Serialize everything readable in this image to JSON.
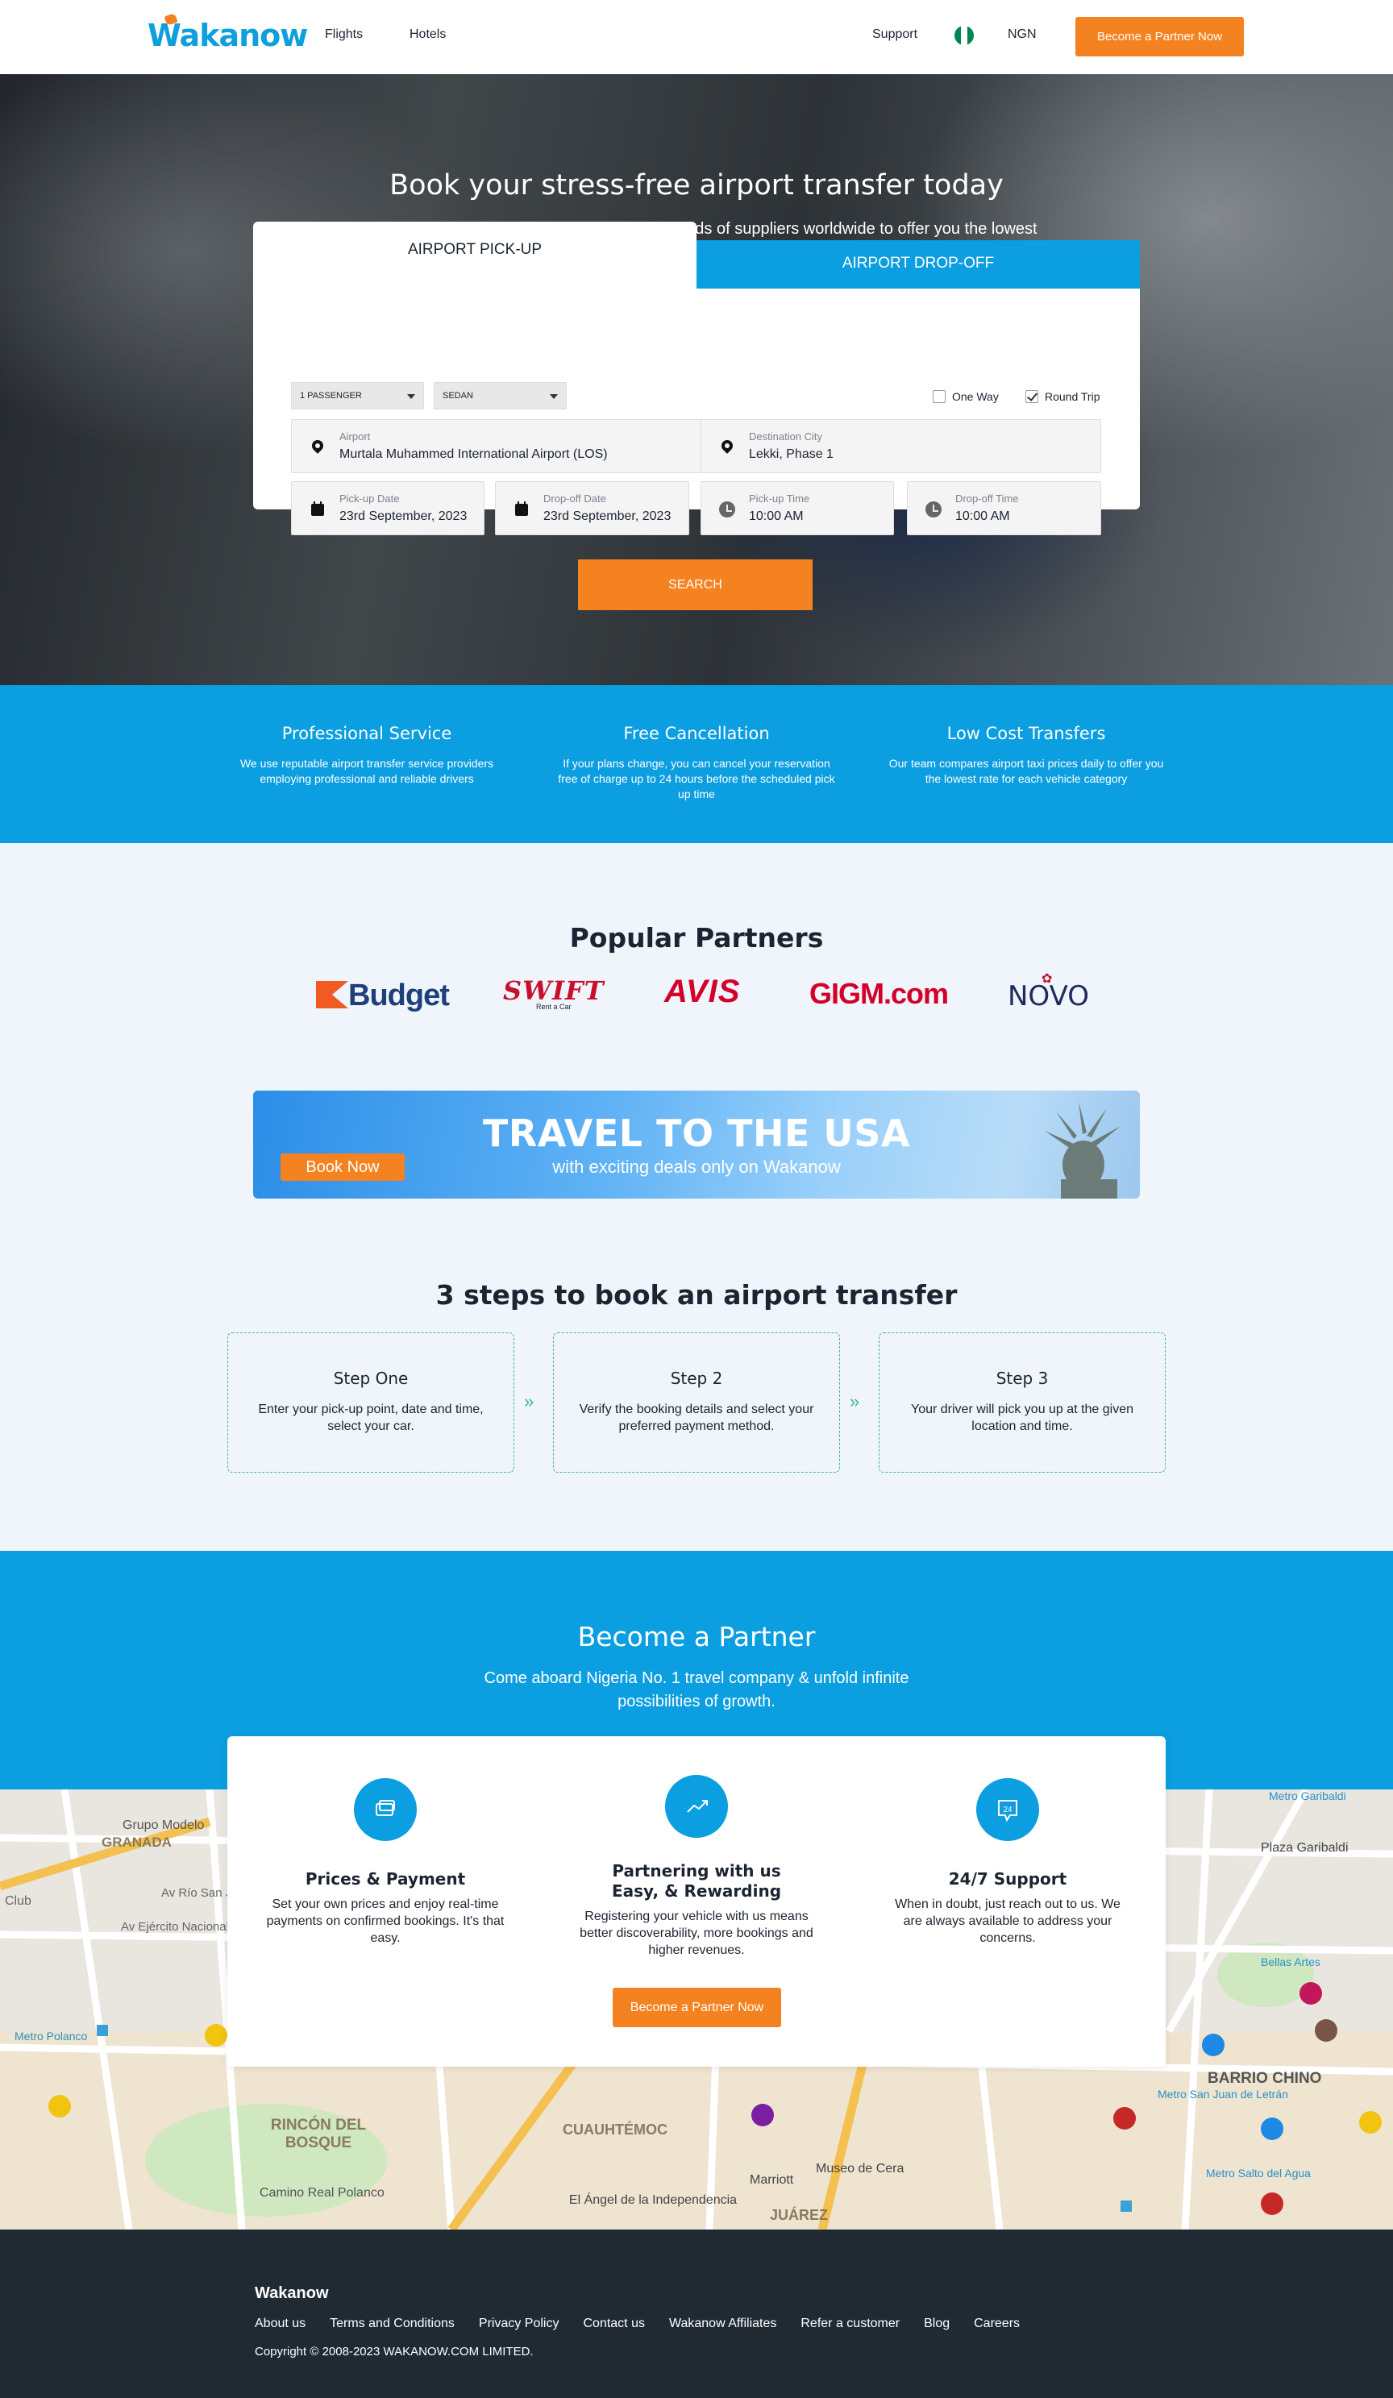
{
  "nav": {
    "logo": "Wakanow",
    "links": [
      "Flights",
      "Hotels"
    ],
    "support": "Support",
    "currency": "NGN",
    "partner_cta": "Become a Partner Now",
    "flag_colors": [
      "#008751",
      "#ffffff",
      "#008751"
    ]
  },
  "hero": {
    "title": "Book your stress-free airport transfer today",
    "subtitle": "We compare airport transfer prices from hundreds of suppliers worldwide to offer you the lowest possible price without compromising the quality of service"
  },
  "booking": {
    "tabs": [
      "AIRPORT PICK-UP",
      "AIRPORT DROP-OFF"
    ],
    "passengers": "1 PASSENGER",
    "vehicle": "SEDAN",
    "trip_options": [
      {
        "label": "One Way",
        "checked": false
      },
      {
        "label": "Round Trip",
        "checked": true
      }
    ],
    "airport": {
      "label": "Airport",
      "value": "Murtala Muhammed International Airport (LOS)"
    },
    "destination": {
      "label": "Destination City",
      "value": "Lekki, Phase 1"
    },
    "pickup_date": {
      "label": "Pick-up Date",
      "value": "23rd September, 2023"
    },
    "dropoff_date": {
      "label": "Drop-off Date",
      "value": "23rd September, 2023"
    },
    "pickup_time": {
      "label": "Pick-up Time",
      "value": "10:00 AM"
    },
    "dropoff_time": {
      "label": "Drop-off Time",
      "value": "10:00 AM"
    },
    "search": "SEARCH"
  },
  "features": [
    {
      "title": "Professional Service",
      "text": "We use reputable airport transfer service providers employing professional and reliable drivers"
    },
    {
      "title": "Free Cancellation",
      "text": "If your plans change, you can cancel your reservation free of charge up to 24 hours before the scheduled pick up time"
    },
    {
      "title": "Low Cost Transfers",
      "text": "Our team compares airport taxi prices daily to offer you the lowest rate for each vehicle category"
    }
  ],
  "partners": {
    "title": "Popular Partners",
    "brands": [
      "Budget",
      "SWIFT",
      "Rent a Car",
      "AVIS",
      "GIGM.com",
      "NOVO"
    ]
  },
  "banner": {
    "title": "TRAVEL TO THE USA",
    "subtitle": "with exciting deals only on Wakanow",
    "cta": "Book Now"
  },
  "steps": {
    "title": "3 steps to book an airport transfer",
    "items": [
      {
        "title": "Step One",
        "text": "Enter your pick-up point, date and time, select your car."
      },
      {
        "title": "Step 2",
        "text": "Verify the booking details and select your preferred payment method."
      },
      {
        "title": "Step 3",
        "text": "Your driver will pick you up at the given location and time."
      }
    ]
  },
  "become_partner": {
    "title": "Become a Partner",
    "subtitle": "Come aboard Nigeria No. 1 travel company & unfold infinite possibilities of growth.",
    "columns": [
      {
        "title": "Prices & Payment",
        "text": "Set your own prices and enjoy real-time payments on confirmed bookings. It's that easy."
      },
      {
        "title": "Partnering with us Easy, & Rewarding",
        "text": "Registering your vehicle with us means better discoverability, more bookings and higher revenues."
      },
      {
        "title": "24/7 Support",
        "text": "When in doubt, just reach out to us. We are always available to address your concerns."
      }
    ],
    "cta": "Become a Partner Now"
  },
  "map_labels": [
    "Grupo Modelo",
    "GRANADA",
    "Av Río San Joaquín",
    "Club",
    "Av Ejército Nacional",
    "Metro Polanco",
    "RINCÓN DEL BOSQUE",
    "Camino Real Polanco",
    "CUAUHTÉMOC",
    "Marriott",
    "Museo de Cera",
    "El Ángel de la Independencia",
    "JUÁREZ",
    "Plaza Garibaldi",
    "Bellas Artes",
    "BARRIO CHINO",
    "Metro San Juan de Letrán",
    "Metro Salto del Agua",
    "Metro Garibaldi"
  ],
  "footer": {
    "brand": "Wakanow",
    "links": [
      "About us",
      "Terms and Conditions",
      "Privacy Policy",
      "Contact us",
      "Wakanow Affiliates",
      "Refer a customer",
      "Blog",
      "Careers"
    ],
    "copyright": "Copyright © 2008-2023 WAKANOW.COM LIMITED."
  },
  "colors": {
    "primary": "#0b9ee0",
    "accent": "#f58220",
    "footer": "#1f2a33",
    "page": "#f0f5fb"
  }
}
